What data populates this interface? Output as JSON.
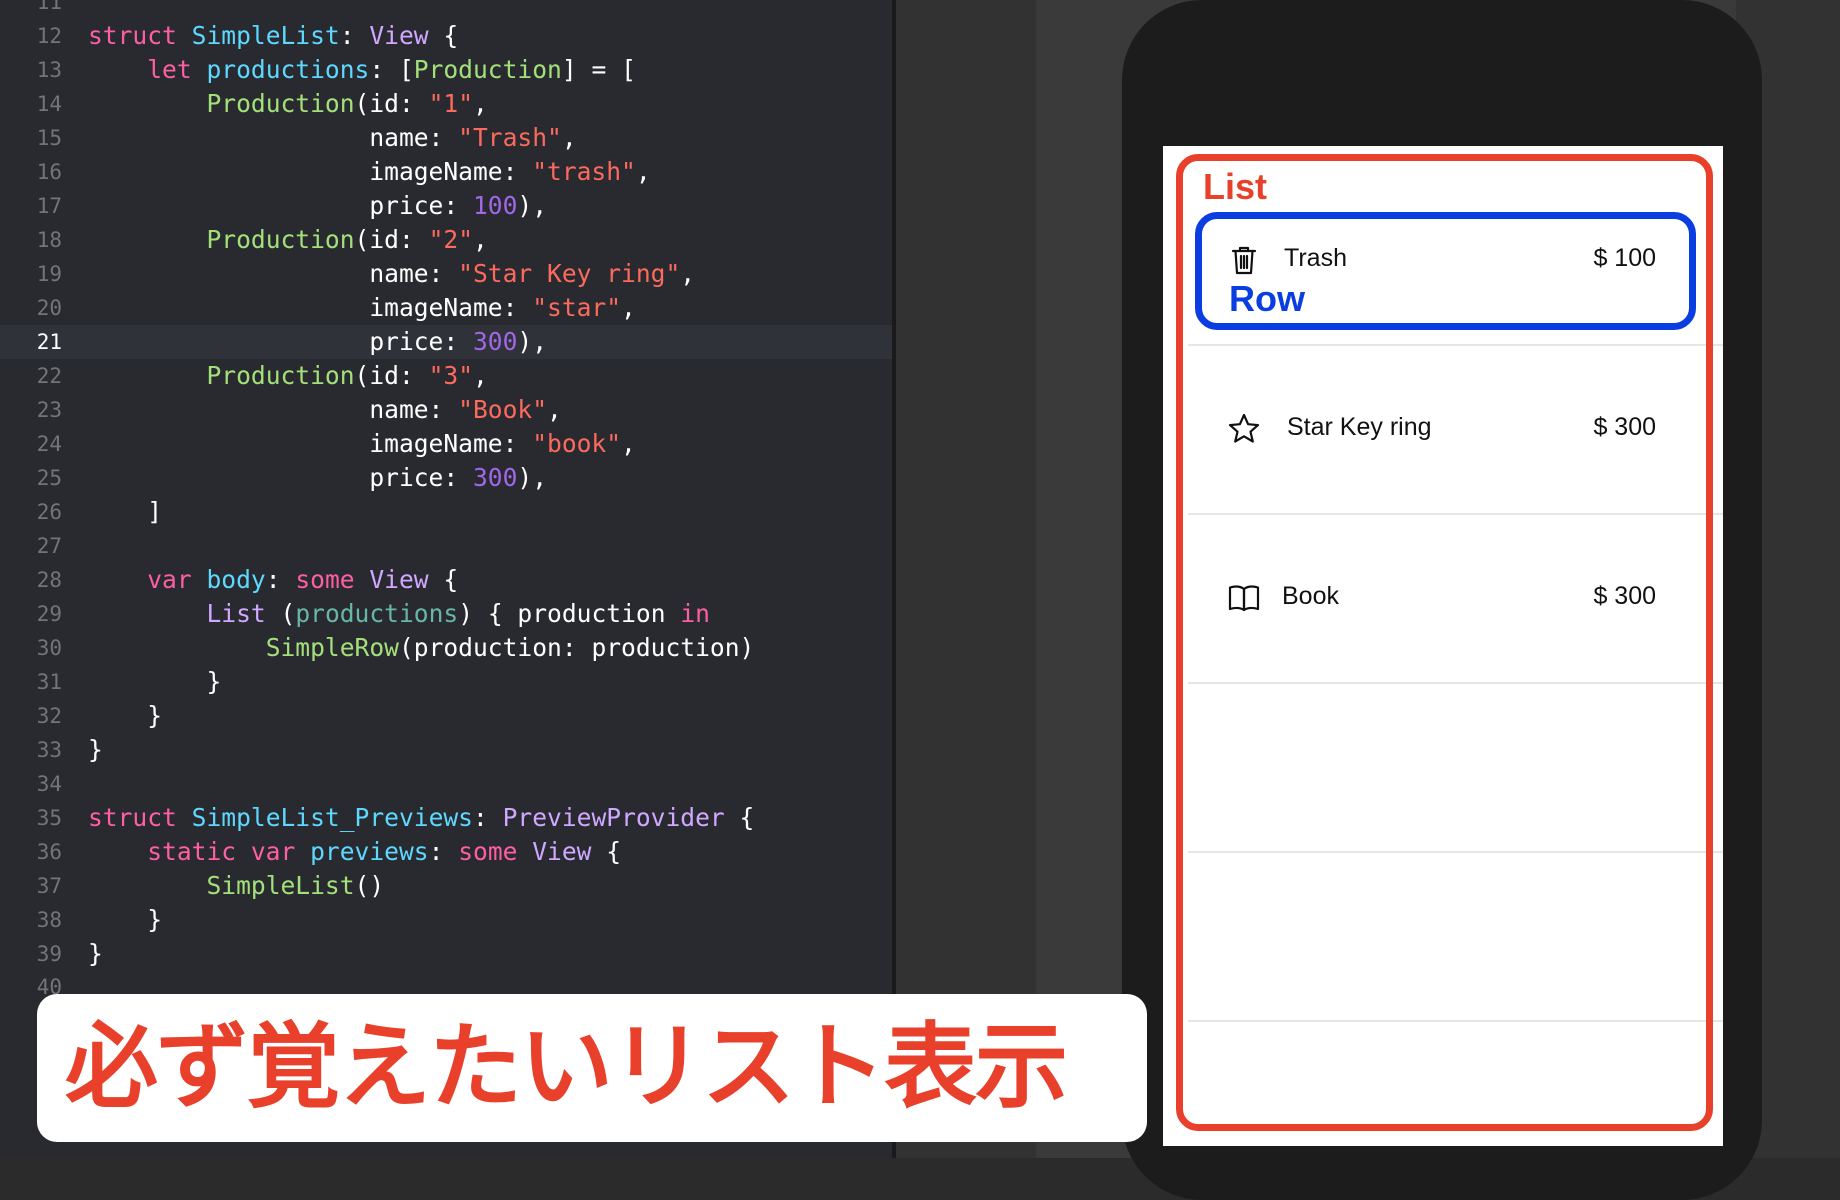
{
  "editor": {
    "current_line": "21",
    "top_partial_line": "11",
    "bottom_partial_line": "40",
    "lines": [
      {
        "n": "12",
        "segs": [
          [
            "kw",
            "struct "
          ],
          [
            "tp",
            "SimpleList"
          ],
          [
            "",
            ": "
          ],
          [
            "ty",
            "View"
          ],
          [
            "",
            " {"
          ]
        ]
      },
      {
        "n": "13",
        "segs": [
          [
            "",
            ""
          ],
          [
            "kw",
            "    let "
          ],
          [
            "tp",
            "productions"
          ],
          [
            "",
            ": ["
          ],
          [
            "cl",
            "Production"
          ],
          [
            "",
            "] = ["
          ]
        ]
      },
      {
        "n": "14",
        "segs": [
          [
            "",
            "        "
          ],
          [
            "cl",
            "Production"
          ],
          [
            "",
            "(id: "
          ],
          [
            "st",
            "\"1\""
          ],
          [
            "",
            ","
          ]
        ]
      },
      {
        "n": "15",
        "segs": [
          [
            "",
            "                   name: "
          ],
          [
            "st",
            "\"Trash\""
          ],
          [
            "",
            ","
          ]
        ]
      },
      {
        "n": "16",
        "segs": [
          [
            "",
            "                   imageName: "
          ],
          [
            "st",
            "\"trash\""
          ],
          [
            "",
            ","
          ]
        ]
      },
      {
        "n": "17",
        "segs": [
          [
            "",
            "                   price: "
          ],
          [
            "pj",
            "100"
          ],
          [
            "",
            "),"
          ]
        ]
      },
      {
        "n": "18",
        "segs": [
          [
            "",
            "        "
          ],
          [
            "cl",
            "Production"
          ],
          [
            "",
            "(id: "
          ],
          [
            "st",
            "\"2\""
          ],
          [
            "",
            ","
          ]
        ]
      },
      {
        "n": "19",
        "segs": [
          [
            "",
            "                   name: "
          ],
          [
            "st",
            "\"Star Key ring\""
          ],
          [
            "",
            ","
          ]
        ]
      },
      {
        "n": "20",
        "segs": [
          [
            "",
            "                   imageName: "
          ],
          [
            "st",
            "\"star\""
          ],
          [
            "",
            ","
          ]
        ]
      },
      {
        "n": "21",
        "segs": [
          [
            "",
            "                   price: "
          ],
          [
            "pj",
            "300"
          ],
          [
            "",
            "),"
          ]
        ]
      },
      {
        "n": "22",
        "segs": [
          [
            "",
            "        "
          ],
          [
            "cl",
            "Production"
          ],
          [
            "",
            "(id: "
          ],
          [
            "st",
            "\"3\""
          ],
          [
            "",
            ","
          ]
        ]
      },
      {
        "n": "23",
        "segs": [
          [
            "",
            "                   name: "
          ],
          [
            "st",
            "\"Book\""
          ],
          [
            "",
            ","
          ]
        ]
      },
      {
        "n": "24",
        "segs": [
          [
            "",
            "                   imageName: "
          ],
          [
            "st",
            "\"book\""
          ],
          [
            "",
            ","
          ]
        ]
      },
      {
        "n": "25",
        "segs": [
          [
            "",
            "                   price: "
          ],
          [
            "pj",
            "300"
          ],
          [
            "",
            "),"
          ]
        ]
      },
      {
        "n": "26",
        "segs": [
          [
            "",
            "    ]"
          ]
        ]
      },
      {
        "n": "27",
        "segs": []
      },
      {
        "n": "28",
        "segs": [
          [
            "kw",
            "    var "
          ],
          [
            "tp",
            "body"
          ],
          [
            "",
            ": "
          ],
          [
            "kw",
            "some "
          ],
          [
            "ty",
            "View"
          ],
          [
            "",
            " {"
          ]
        ]
      },
      {
        "n": "29",
        "segs": [
          [
            "",
            "        "
          ],
          [
            "ty",
            "List"
          ],
          [
            "",
            " ("
          ],
          [
            "pr",
            "productions"
          ],
          [
            "",
            ") { production "
          ],
          [
            "kw",
            "in"
          ]
        ]
      },
      {
        "n": "30",
        "segs": [
          [
            "",
            "            "
          ],
          [
            "cl",
            "SimpleRow"
          ],
          [
            "",
            "(production: production)"
          ]
        ]
      },
      {
        "n": "31",
        "segs": [
          [
            "",
            "        }"
          ]
        ]
      },
      {
        "n": "32",
        "segs": [
          [
            "",
            "    }"
          ]
        ]
      },
      {
        "n": "33",
        "segs": [
          [
            "",
            "}"
          ]
        ]
      },
      {
        "n": "34",
        "segs": []
      },
      {
        "n": "35",
        "segs": [
          [
            "kw",
            "struct "
          ],
          [
            "tp",
            "SimpleList_Previews"
          ],
          [
            "",
            ": "
          ],
          [
            "ty",
            "PreviewProvider"
          ],
          [
            "",
            " {"
          ]
        ]
      },
      {
        "n": "36",
        "segs": [
          [
            "kw",
            "    static var "
          ],
          [
            "tp",
            "previews"
          ],
          [
            "",
            ": "
          ],
          [
            "kw",
            "some "
          ],
          [
            "ty",
            "View"
          ],
          [
            "",
            " {"
          ]
        ]
      },
      {
        "n": "37",
        "segs": [
          [
            "",
            "        "
          ],
          [
            "cl",
            "SimpleList"
          ],
          [
            "",
            "()"
          ]
        ]
      },
      {
        "n": "38",
        "segs": [
          [
            "",
            "    }"
          ]
        ]
      },
      {
        "n": "39",
        "segs": [
          [
            "",
            "}"
          ]
        ]
      }
    ]
  },
  "preview": {
    "list_label": "List",
    "row_label": "Row",
    "rows": [
      {
        "name": "Trash",
        "price": "$ 100",
        "icon": "trash-icon"
      },
      {
        "name": "Star Key ring",
        "price": "$ 300",
        "icon": "star-icon"
      },
      {
        "name": "Book",
        "price": "$ 300",
        "icon": "book-icon"
      }
    ]
  },
  "banner": {
    "text": "必ず覚えたいリスト表示"
  },
  "colors": {
    "list_outline": "#e8402a",
    "row_outline": "#0a3ee0",
    "banner_text": "#e8402a",
    "editor_bg": "#292a30"
  }
}
